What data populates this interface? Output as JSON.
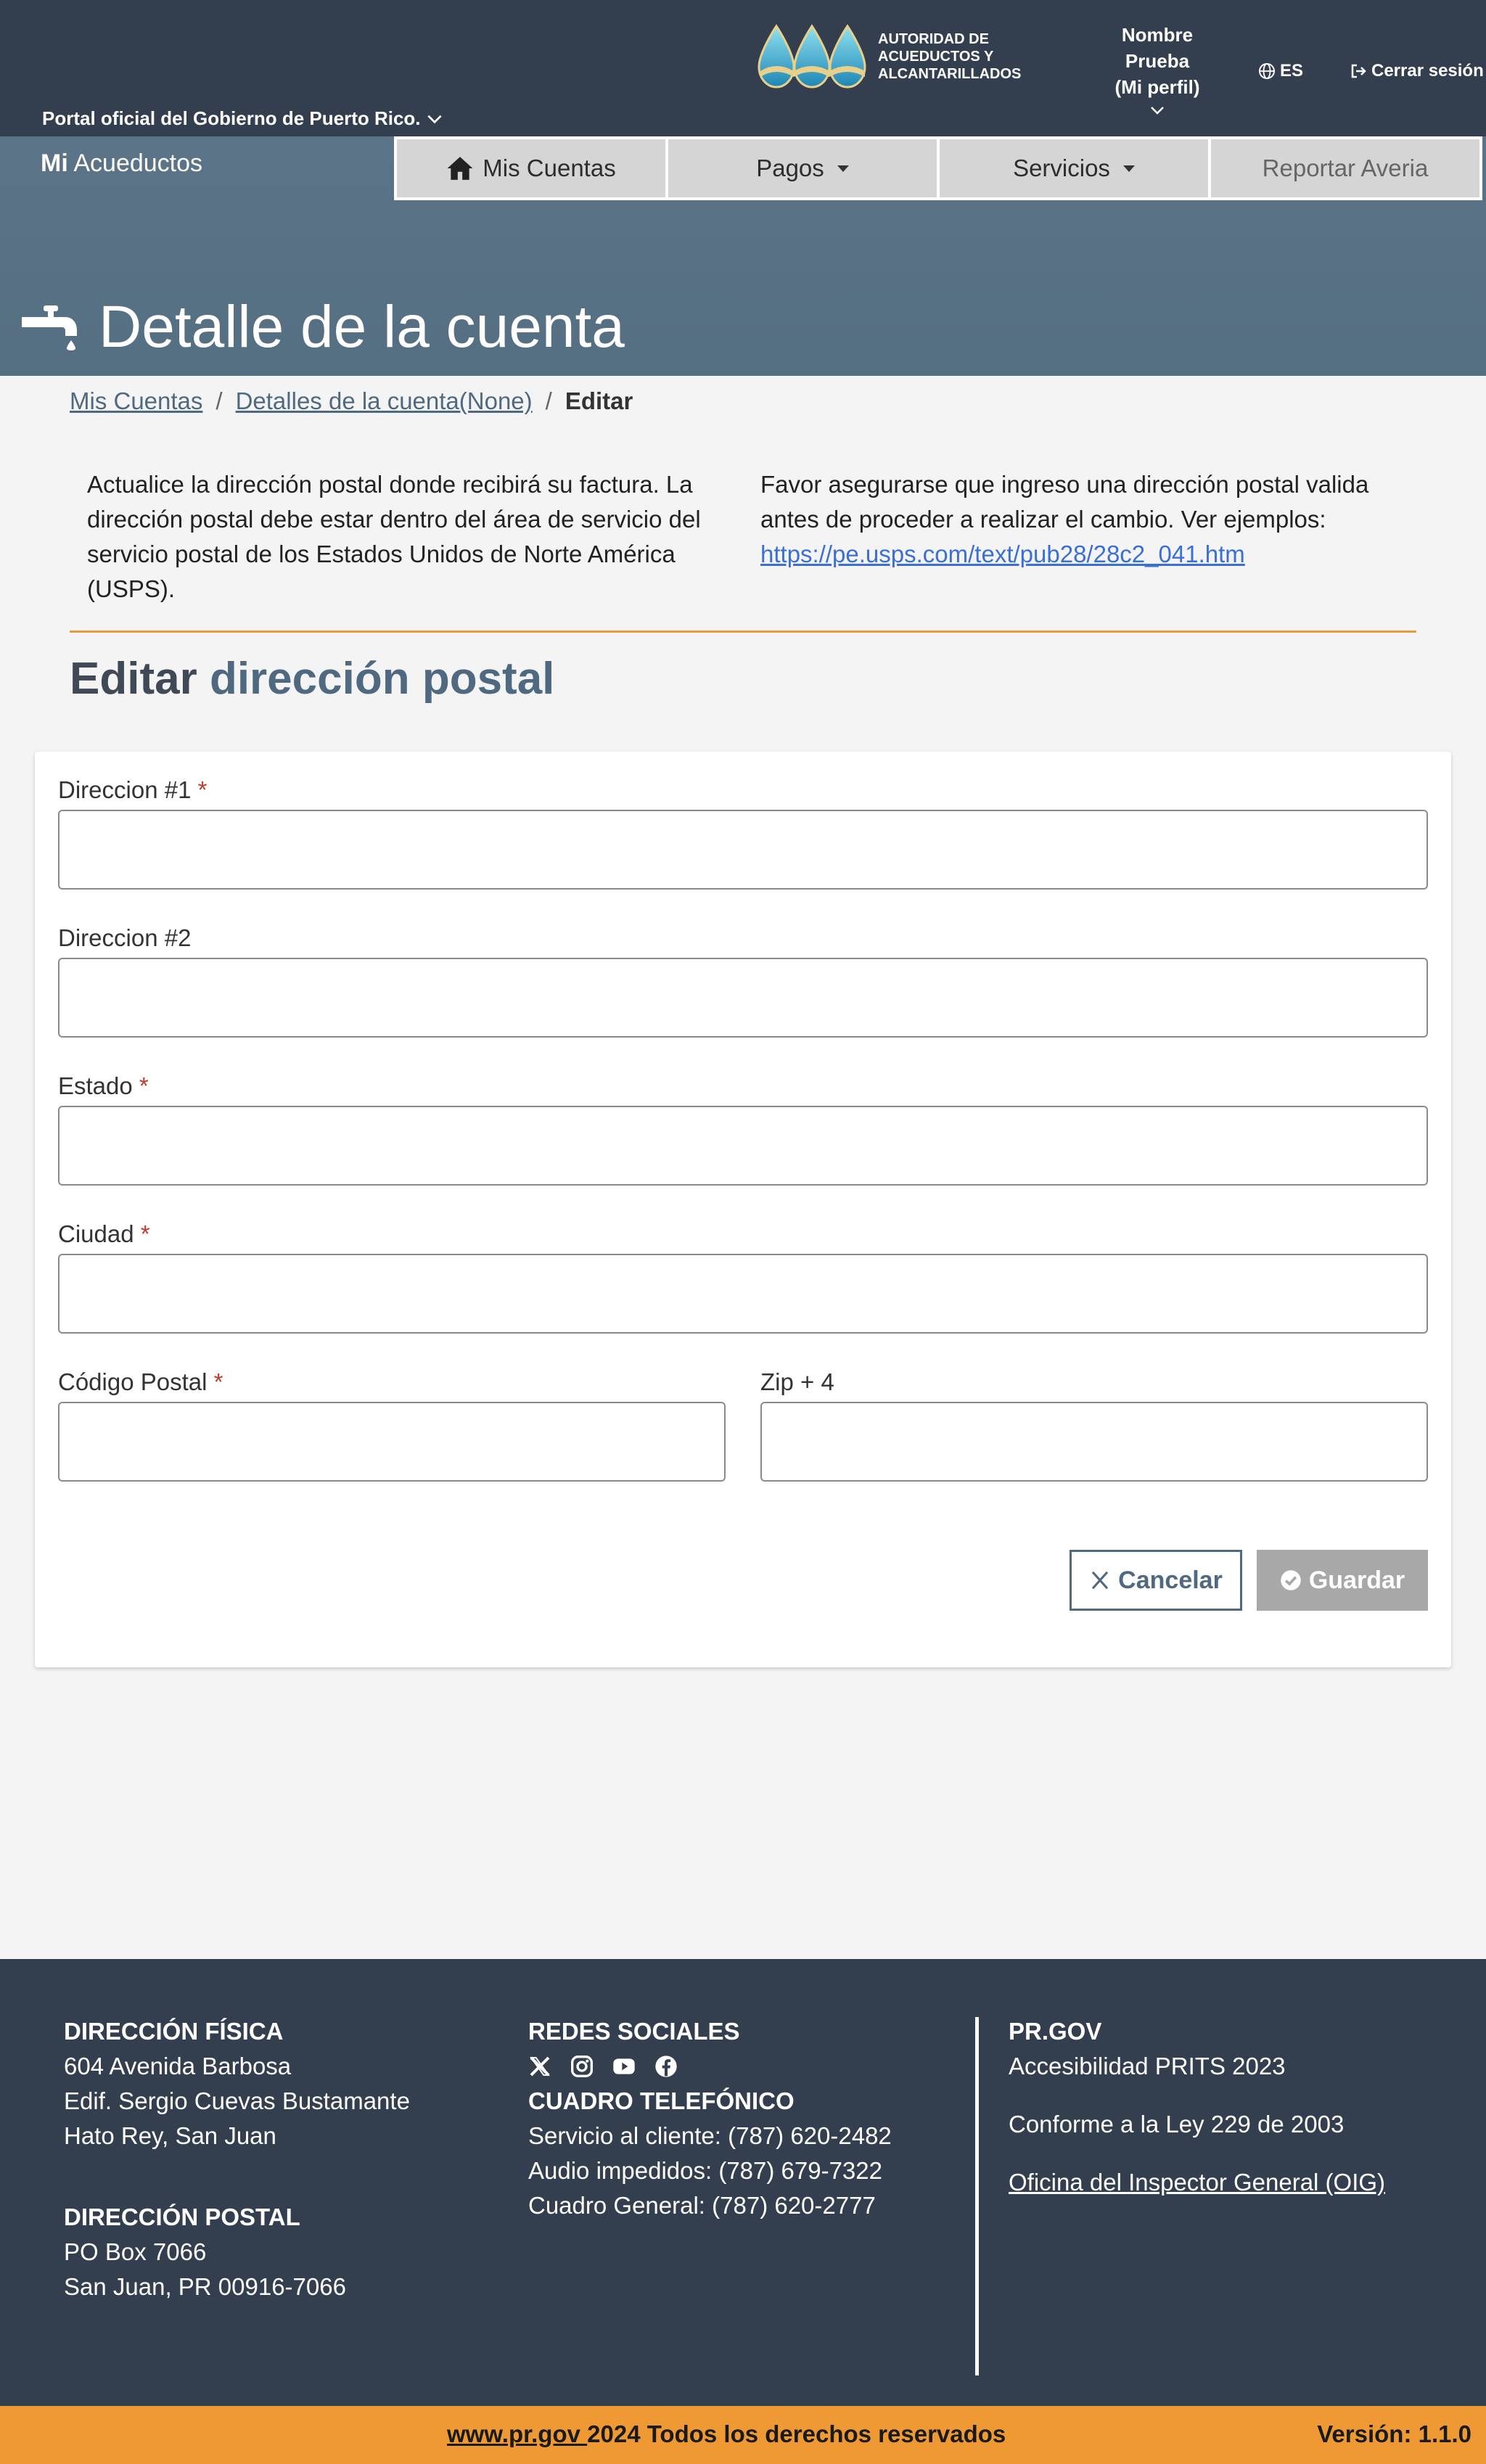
{
  "header": {
    "gov_portal": "Portal oficial del Gobierno de Puerto Rico.",
    "logo_text": "AUTORIDAD DE ACUEDUCTOS Y ALCANTARILLADOS",
    "profile": {
      "line1": "Nombre",
      "line2": "Prueba",
      "line3": "(Mi perfil)"
    },
    "language": "ES",
    "logout": "Cerrar sesión"
  },
  "brand": {
    "bold": "Mi",
    "name": "Acueductos"
  },
  "nav": {
    "items": [
      {
        "label": "Mis Cuentas",
        "icon": "home-icon"
      },
      {
        "label": "Pagos",
        "icon": "caret-down-icon"
      },
      {
        "label": "Servicios",
        "icon": "caret-down-icon"
      },
      {
        "label": "Reportar Averia"
      }
    ]
  },
  "page": {
    "title": "Detalle de la cuenta",
    "title_icon": "faucet-icon"
  },
  "breadcrumb": {
    "items": [
      "Mis Cuentas",
      "Detalles de la cuenta(None)",
      "Editar"
    ],
    "separator": "/"
  },
  "info": {
    "left": "Actualice la dirección postal donde recibirá su factura. La dirección postal debe estar dentro del área de servicio del servicio postal de los Estados Unidos de Norte América (USPS).",
    "right": "Favor asegurarse que ingreso una dirección postal valida antes de proceder a realizar el cambio. Ver ejemplos:",
    "link": "https://pe.usps.com/text/pub28/28c2_041.htm"
  },
  "section": {
    "prefix": "Editar",
    "highlight": "dirección postal"
  },
  "form": {
    "direccion1": {
      "label": "Direccion #1",
      "required": "*",
      "value": ""
    },
    "direccion2": {
      "label": "Direccion #2",
      "value": ""
    },
    "estado": {
      "label": "Estado",
      "required": "*",
      "value": ""
    },
    "ciudad": {
      "label": "Ciudad",
      "required": "*",
      "value": ""
    },
    "codigo_postal": {
      "label": "Código Postal",
      "required": "*",
      "value": ""
    },
    "zip4": {
      "label": "Zip + 4",
      "value": ""
    },
    "cancel_label": "Cancelar",
    "save_label": "Guardar"
  },
  "footer": {
    "direccion_fisica": {
      "title": "DIRECCIÓN FÍSICA",
      "lines": [
        "604 Avenida Barbosa",
        "Edif. Sergio Cuevas Bustamante",
        "Hato Rey, San Juan"
      ]
    },
    "direccion_postal": {
      "title": "DIRECCIÓN POSTAL",
      "lines": [
        "PO Box 7066",
        "San Juan, PR 00916-7066"
      ]
    },
    "redes_sociales": {
      "title": "REDES SOCIALES",
      "icons": [
        "x-icon",
        "instagram-icon",
        "youtube-icon",
        "facebook-icon"
      ]
    },
    "cuadro": {
      "title": "CUADRO TELEFÓNICO",
      "lines": [
        "Servicio al cliente: (787) 620-2482",
        "Audio impedidos: (787) 679-7322",
        "Cuadro General: (787) 620-2777"
      ]
    },
    "prgov": {
      "title": "PR.GOV",
      "line1": "Accesibilidad PRITS 2023",
      "line2": "Conforme a la Ley 229 de 2003",
      "link": "Oficina del Inspector General (OIG)"
    }
  },
  "bottombar": {
    "link": "www.pr.gov ",
    "text": "2024 Todos los derechos reservados",
    "version": "Versión: 1.1.0"
  },
  "colors": {
    "top_bar": "#333f4f",
    "header_band": "#546e82",
    "accent_orange": "#ee9933",
    "primary": "#4f6a80",
    "required": "#c0392b"
  }
}
